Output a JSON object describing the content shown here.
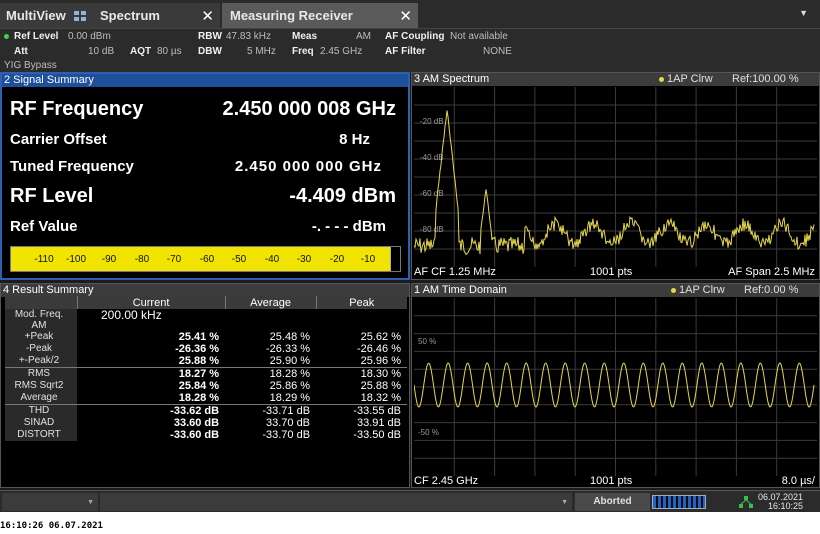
{
  "tabs": [
    {
      "label": "MultiView"
    },
    {
      "label": "Spectrum"
    },
    {
      "label": "Measuring Receiver"
    }
  ],
  "settings": {
    "ref_level_label": "Ref Level",
    "ref_level_value": "0.00 dBm",
    "att_label": "Att",
    "att_value": "10 dB",
    "aqt_label": "AQT",
    "aqt_value": "80 µs",
    "rbw_label": "RBW",
    "rbw_value": "47.83 kHz",
    "dbw_label": "DBW",
    "dbw_value": "5 MHz",
    "meas_label": "Meas",
    "meas_value": "AM",
    "freq_label": "Freq",
    "freq_value": "2.45 GHz",
    "af_coupling_label": "AF Coupling",
    "af_coupling_value": "Not available",
    "af_filter_label": "AF Filter",
    "af_filter_value": "NONE",
    "yig": "YIG Bypass"
  },
  "signal_summary": {
    "title": "2 Signal Summary",
    "rows": [
      {
        "label": "RF Frequency",
        "value": "2.450 000 008 GHz"
      },
      {
        "label": "Carrier Offset",
        "value": "8 Hz"
      },
      {
        "label": "Tuned Frequency",
        "value": "2.450 000 000 GHz"
      },
      {
        "label": "RF Level",
        "value": "-4.409 dBm"
      },
      {
        "label": "Ref Value",
        "value": "-. - - - dBm"
      }
    ],
    "level_bar_ticks": [
      "-110",
      "-100",
      "-90",
      "-80",
      "-70",
      "-60",
      "-50",
      "-40",
      "-30",
      "-20",
      "-10"
    ],
    "level_bar_color": "#f0e400"
  },
  "result_summary": {
    "title": "4 Result Summary",
    "columns": [
      "Current",
      "Average",
      "Peak"
    ],
    "mod_freq_label": "Mod. Freq.",
    "mod_freq_unit": "AM",
    "mod_freq_value": "200.00 kHz",
    "rows": [
      {
        "label": "+Peak",
        "current": "25.41 %",
        "average": "25.48 %",
        "peak": "25.62 %"
      },
      {
        "label": "-Peak",
        "current": "-26.36 %",
        "average": "-26.33 %",
        "peak": "-26.46 %"
      },
      {
        "label": "+-Peak/2",
        "current": "25.88 %",
        "average": "25.90 %",
        "peak": "25.96 %"
      },
      {
        "label": "RMS",
        "current": "18.27 %",
        "average": "18.28 %",
        "peak": "18.30 %"
      },
      {
        "label": "RMS Sqrt2",
        "current": "25.84 %",
        "average": "25.86 %",
        "peak": "25.88 %"
      },
      {
        "label": "Average",
        "current": "18.28 %",
        "average": "18.29 %",
        "peak": "18.32 %"
      },
      {
        "label": "THD",
        "current": "-33.62 dB",
        "average": "-33.71 dB",
        "peak": "-33.55 dB"
      },
      {
        "label": "SINAD",
        "current": "33.60 dB",
        "average": "33.70 dB",
        "peak": "33.91 dB"
      },
      {
        "label": "DISTORT",
        "current": "-33.60 dB",
        "average": "-33.70 dB",
        "peak": "-33.50 dB"
      }
    ]
  },
  "am_spectrum": {
    "title": "3 AM Spectrum",
    "trace": "1AP Clrw",
    "ref": "Ref:100.00 %",
    "y_ticks": [
      "-20 dB",
      "-40 dB",
      "-60 dB",
      "-80 dB"
    ],
    "foot_left": "AF CF 1.25 MHz",
    "foot_mid": "1001 pts",
    "foot_right": "AF Span 2.5 MHz",
    "trace_color": "#e6d84a"
  },
  "time_domain": {
    "title": "1 AM Time Domain",
    "trace": "1AP Clrw",
    "ref": "Ref:0.00 %",
    "y_ticks": [
      "50 %",
      "-50 %"
    ],
    "foot_left": "CF 2.45 GHz",
    "foot_mid": "1001 pts",
    "foot_right": "8.0 µs/",
    "trace_color": "#e6d84a"
  },
  "status": {
    "state": "Aborted",
    "date": "06.07.2021",
    "time": "16:10:25"
  },
  "footer_stamp": "16:10:26  06.07.2021"
}
